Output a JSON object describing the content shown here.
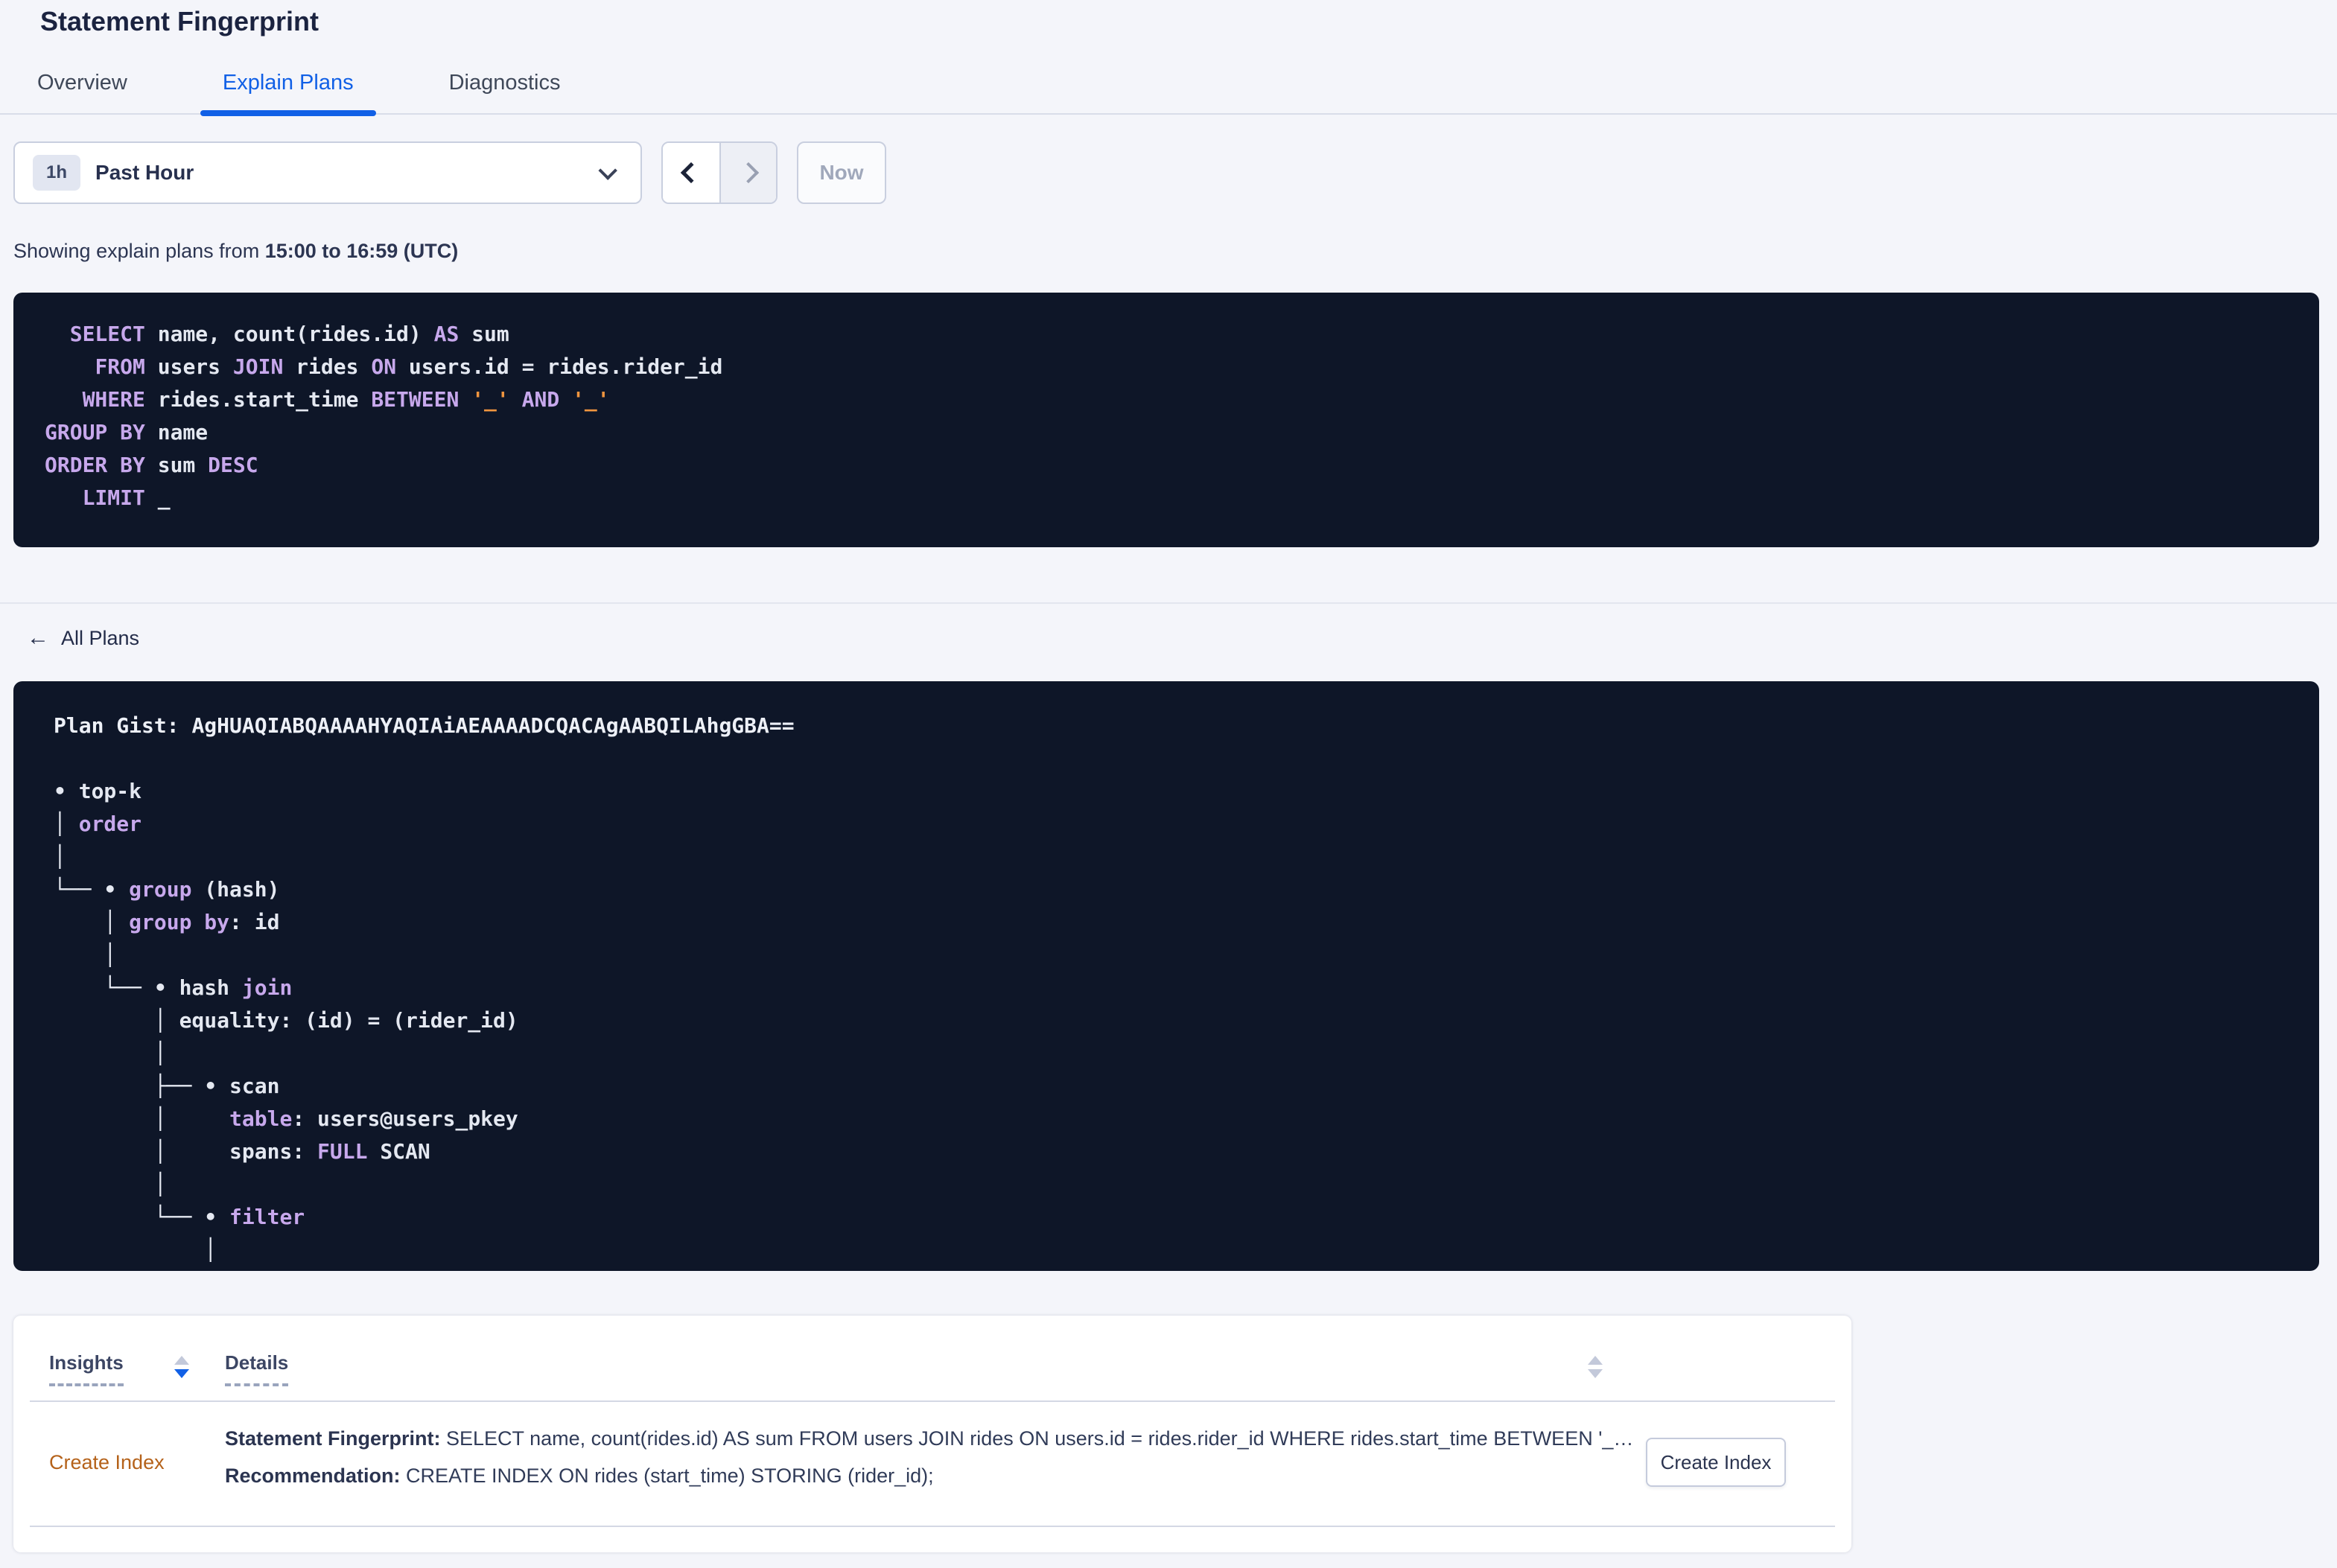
{
  "page": {
    "title": "Statement Fingerprint"
  },
  "tabs": [
    {
      "label": "Overview",
      "active": false
    },
    {
      "label": "Explain Plans",
      "active": true
    },
    {
      "label": "Diagnostics",
      "active": false
    }
  ],
  "time_picker": {
    "badge": "1h",
    "label": "Past Hour",
    "now_label": "Now"
  },
  "summary": {
    "prefix": "Showing explain plans from ",
    "range": "15:00 to 16:59 (UTC)"
  },
  "sql": {
    "lines": [
      [
        {
          "t": "  ",
          "c": "p"
        },
        {
          "t": "SELECT",
          "c": "k"
        },
        {
          "t": " name, count(rides.id) ",
          "c": "p"
        },
        {
          "t": "AS",
          "c": "k"
        },
        {
          "t": " sum",
          "c": "p"
        }
      ],
      [
        {
          "t": "    ",
          "c": "p"
        },
        {
          "t": "FROM",
          "c": "k"
        },
        {
          "t": " users ",
          "c": "p"
        },
        {
          "t": "JOIN",
          "c": "k"
        },
        {
          "t": " rides ",
          "c": "p"
        },
        {
          "t": "ON",
          "c": "k"
        },
        {
          "t": " users.id = rides.rider_id",
          "c": "p"
        }
      ],
      [
        {
          "t": "   ",
          "c": "p"
        },
        {
          "t": "WHERE",
          "c": "k"
        },
        {
          "t": " rides.start_time ",
          "c": "p"
        },
        {
          "t": "BETWEEN",
          "c": "k"
        },
        {
          "t": " ",
          "c": "p"
        },
        {
          "t": "'_'",
          "c": "o"
        },
        {
          "t": " ",
          "c": "p"
        },
        {
          "t": "AND",
          "c": "k"
        },
        {
          "t": " ",
          "c": "p"
        },
        {
          "t": "'_'",
          "c": "o"
        }
      ],
      [
        {
          "t": "GROUP BY",
          "c": "k"
        },
        {
          "t": " name",
          "c": "p"
        }
      ],
      [
        {
          "t": "ORDER BY",
          "c": "k"
        },
        {
          "t": " sum ",
          "c": "p"
        },
        {
          "t": "DESC",
          "c": "k"
        }
      ],
      [
        {
          "t": "   ",
          "c": "p"
        },
        {
          "t": "LIMIT",
          "c": "k"
        },
        {
          "t": " _",
          "c": "p"
        }
      ]
    ]
  },
  "back_link": {
    "label": "All Plans",
    "icon": "←"
  },
  "plan": {
    "gist_label": "Plan Gist: ",
    "gist": "AgHUAQIABQAAAAHYAQIAiAEAAAADCQACAgAABQILAhgGBA==",
    "tree_lines": [
      [
        {
          "t": "• ",
          "c": "p"
        },
        {
          "t": "top-k",
          "c": "p"
        }
      ],
      [
        {
          "t": "│ ",
          "c": "p"
        },
        {
          "t": "order",
          "c": "k"
        }
      ],
      [
        {
          "t": "│",
          "c": "p"
        }
      ],
      [
        {
          "t": "└── • ",
          "c": "p"
        },
        {
          "t": "group",
          "c": "k"
        },
        {
          "t": " (hash)",
          "c": "p"
        }
      ],
      [
        {
          "t": "    │ ",
          "c": "p"
        },
        {
          "t": "group by",
          "c": "k"
        },
        {
          "t": ": id",
          "c": "p"
        }
      ],
      [
        {
          "t": "    │",
          "c": "p"
        }
      ],
      [
        {
          "t": "    └── • ",
          "c": "p"
        },
        {
          "t": "hash ",
          "c": "p"
        },
        {
          "t": "join",
          "c": "k"
        }
      ],
      [
        {
          "t": "        │ ",
          "c": "p"
        },
        {
          "t": "equality: (id) = (rider_id)",
          "c": "p"
        }
      ],
      [
        {
          "t": "        │",
          "c": "p"
        }
      ],
      [
        {
          "t": "        ├── • ",
          "c": "p"
        },
        {
          "t": "scan",
          "c": "p"
        }
      ],
      [
        {
          "t": "        │     ",
          "c": "p"
        },
        {
          "t": "table",
          "c": "k"
        },
        {
          "t": ": users@users_pkey",
          "c": "p"
        }
      ],
      [
        {
          "t": "        │     ",
          "c": "p"
        },
        {
          "t": "spans: ",
          "c": "p"
        },
        {
          "t": "FULL",
          "c": "k"
        },
        {
          "t": " SCAN",
          "c": "p"
        }
      ],
      [
        {
          "t": "        │",
          "c": "p"
        }
      ],
      [
        {
          "t": "        └── • ",
          "c": "p"
        },
        {
          "t": "filter",
          "c": "k"
        }
      ],
      [
        {
          "t": "            │",
          "c": "p"
        }
      ]
    ]
  },
  "insights_table": {
    "columns": [
      {
        "label": "Insights"
      },
      {
        "label": "Details"
      }
    ],
    "row": {
      "insight_type": "Create Index",
      "detail_lines": [
        {
          "label": "Statement Fingerprint:",
          "text": " SELECT name, count(rides.id) AS sum FROM users JOIN rides ON users.id = rides.rider_id WHERE rides.start_time BETWEEN '_…"
        },
        {
          "label": "Recommendation:",
          "text": " CREATE INDEX ON rides (start_time) STORING (rider_id);"
        }
      ],
      "action_label": "Create Index"
    }
  },
  "colors": {
    "accent_blue": "#1160e6",
    "code_bg": "#0e1628",
    "keyword_purple": "#c7a8ec",
    "literal_orange": "#f0953f",
    "insight_orange": "#b5621a"
  }
}
